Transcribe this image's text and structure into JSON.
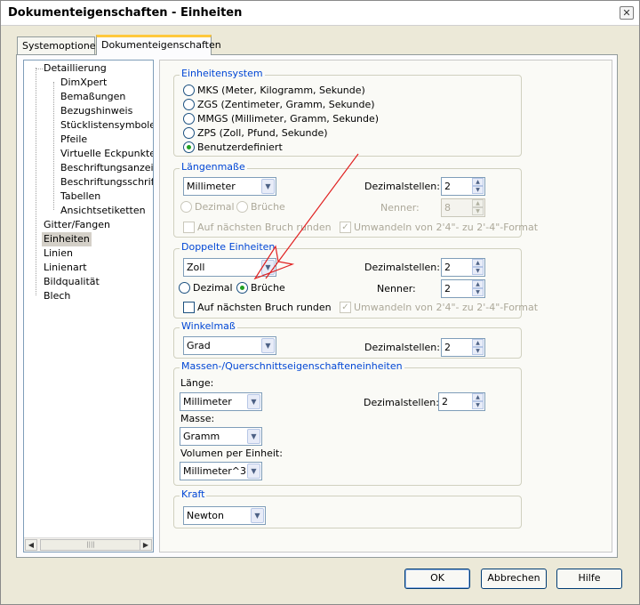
{
  "window": {
    "title": "Dokumenteigenschaften - Einheiten",
    "close_glyph": "✕"
  },
  "tabs": [
    {
      "label": "Systemoptionen"
    },
    {
      "label": "Dokumenteigenschaften"
    }
  ],
  "tree": {
    "items": [
      {
        "label": "Detaillierung"
      },
      {
        "label": "DimXpert"
      },
      {
        "label": "Bemaßungen"
      },
      {
        "label": "Bezugshinweis"
      },
      {
        "label": "Stücklistensymbole"
      },
      {
        "label": "Pfeile"
      },
      {
        "label": "Virtuelle Eckpunkte"
      },
      {
        "label": "Beschriftungsanzeige"
      },
      {
        "label": "Beschriftungsschriftart"
      },
      {
        "label": "Tabellen"
      },
      {
        "label": "Ansichtsetiketten"
      },
      {
        "label": "Gitter/Fangen"
      },
      {
        "label": "Einheiten"
      },
      {
        "label": "Linien"
      },
      {
        "label": "Linienart"
      },
      {
        "label": "Bildqualität"
      },
      {
        "label": "Blech"
      }
    ],
    "selected": "Einheiten",
    "scroll_left": "◀",
    "scroll_right": "▶",
    "scroll_grip": "||||"
  },
  "einheitensystem": {
    "title": "Einheitensystem",
    "options": [
      {
        "label": "MKS  (Meter, Kilogramm, Sekunde)",
        "selected": false
      },
      {
        "label": "ZGS  (Zentimeter, Gramm, Sekunde)",
        "selected": false
      },
      {
        "label": "MMGS (Millimeter, Gramm, Sekunde)",
        "selected": false
      },
      {
        "label": "ZPS  (Zoll, Pfund, Sekunde)",
        "selected": false
      },
      {
        "label": "Benutzerdefiniert",
        "selected": true
      }
    ]
  },
  "laengenmasse": {
    "title": "Längenmaße",
    "unit": "Millimeter",
    "dezimalstellen_label": "Dezimalstellen:",
    "dezimalstellen": "2",
    "dezimal_label": "Dezimal",
    "brueche_label": "Brüche",
    "nenner_label": "Nenner:",
    "nenner": "8",
    "runden_label": "Auf nächsten Bruch runden",
    "umwandeln_label": "Umwandeln von 2'4\"- zu 2'-4\"-Format"
  },
  "doppelte": {
    "title": "Doppelte Einheiten",
    "unit": "Zoll",
    "dezimalstellen_label": "Dezimalstellen:",
    "dezimalstellen": "2",
    "dezimal_label": "Dezimal",
    "brueche_label": "Brüche",
    "nenner_label": "Nenner:",
    "nenner": "2",
    "runden_label": "Auf nächsten Bruch runden",
    "umwandeln_label": "Umwandeln von 2'4\"- zu 2'-4\"-Format"
  },
  "winkelmass": {
    "title": "Winkelmaß",
    "unit": "Grad",
    "dezimalstellen_label": "Dezimalstellen:",
    "dezimalstellen": "2"
  },
  "massen": {
    "title": "Massen-/Querschnittseigenschafteneinheiten",
    "laenge_label": "Länge:",
    "laenge": "Millimeter",
    "dezimalstellen_label": "Dezimalstellen:",
    "dezimalstellen": "2",
    "masse_label": "Masse:",
    "masse": "Gramm",
    "volumen_label": "Volumen per Einheit:",
    "volumen": "Millimeter^3"
  },
  "kraft": {
    "title": "Kraft",
    "unit": "Newton"
  },
  "glyphs": {
    "drop": "▼",
    "up": "▲",
    "down": "▼",
    "check": "✓"
  },
  "buttons": {
    "ok": "OK",
    "cancel": "Abbrechen",
    "help": "Hilfe"
  },
  "colors": {
    "group_title": "#0046d5",
    "tab_accent": "#ffc83c",
    "annotation_arrow": "#e02020"
  }
}
